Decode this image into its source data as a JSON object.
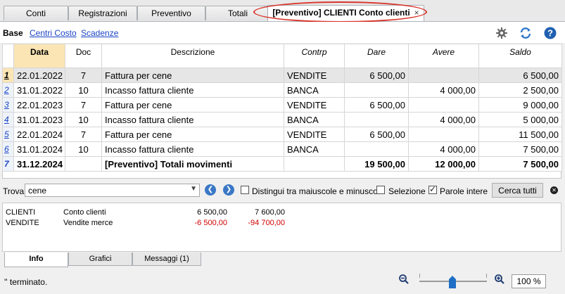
{
  "tabs": [
    {
      "label": "Conti"
    },
    {
      "label": "Registrazioni"
    },
    {
      "label": "Preventivo"
    },
    {
      "label": "Totali"
    },
    {
      "label": "[Preventivo] CLIENTI Conto clienti"
    }
  ],
  "tab_close": "×",
  "views": {
    "current": "Base",
    "links": [
      "Centri Costo",
      "Scadenze"
    ]
  },
  "columns": [
    "Data",
    "Doc",
    "Descrizione",
    "Contrp",
    "Dare",
    "Avere",
    "Saldo"
  ],
  "rows": [
    {
      "n": "1",
      "data": "22.01.2022",
      "doc": "7",
      "desc": "Fattura per cene",
      "contrp": "VENDITE",
      "dare": "6 500,00",
      "avere": "",
      "saldo": "6 500,00"
    },
    {
      "n": "2",
      "data": "31.01.2022",
      "doc": "10",
      "desc": "Incasso fattura cliente",
      "contrp": "BANCA",
      "dare": "",
      "avere": "4 000,00",
      "saldo": "2 500,00"
    },
    {
      "n": "3",
      "data": "22.01.2023",
      "doc": "7",
      "desc": "Fattura per cene",
      "contrp": "VENDITE",
      "dare": "6 500,00",
      "avere": "",
      "saldo": "9 000,00"
    },
    {
      "n": "4",
      "data": "31.01.2023",
      "doc": "10",
      "desc": "Incasso fattura cliente",
      "contrp": "BANCA",
      "dare": "",
      "avere": "4 000,00",
      "saldo": "5 000,00"
    },
    {
      "n": "5",
      "data": "22.01.2024",
      "doc": "7",
      "desc": "Fattura per cene",
      "contrp": "VENDITE",
      "dare": "6 500,00",
      "avere": "",
      "saldo": "11 500,00"
    },
    {
      "n": "6",
      "data": "31.01.2024",
      "doc": "10",
      "desc": "Incasso fattura cliente",
      "contrp": "BANCA",
      "dare": "",
      "avere": "4 000,00",
      "saldo": "7 500,00"
    },
    {
      "n": "7",
      "data": "31.12.2024",
      "doc": "",
      "desc": "[Preventivo] Totali movimenti",
      "contrp": "",
      "dare": "19 500,00",
      "avere": "12 000,00",
      "saldo": "7 500,00"
    }
  ],
  "find": {
    "label": "Trova",
    "value": "cene",
    "case_label": "Distingui tra maiuscole e minuscole",
    "selection_label": "Selezione",
    "whole_label": "Parole intere",
    "whole_checked": true,
    "search_all": "Cerca tutti"
  },
  "info_rows": [
    {
      "account": "CLIENTI",
      "desc": "Conto clienti",
      "v1": "6 500,00",
      "v2": "7 600,00"
    },
    {
      "account": "VENDITE",
      "desc": "Vendite merce",
      "v1": "-6 500,00",
      "v2": "-94 700,00"
    }
  ],
  "bottom_tabs": [
    "Info",
    "Grafici",
    "Messaggi (1)"
  ],
  "status": "'' terminato.",
  "zoom": "100 %",
  "zoom_level_percent": 100,
  "colors": {
    "accent": "#3a78c5",
    "highlight_ellipse": "#d9342b",
    "negative": "#d10000",
    "link": "#1a44c5"
  }
}
